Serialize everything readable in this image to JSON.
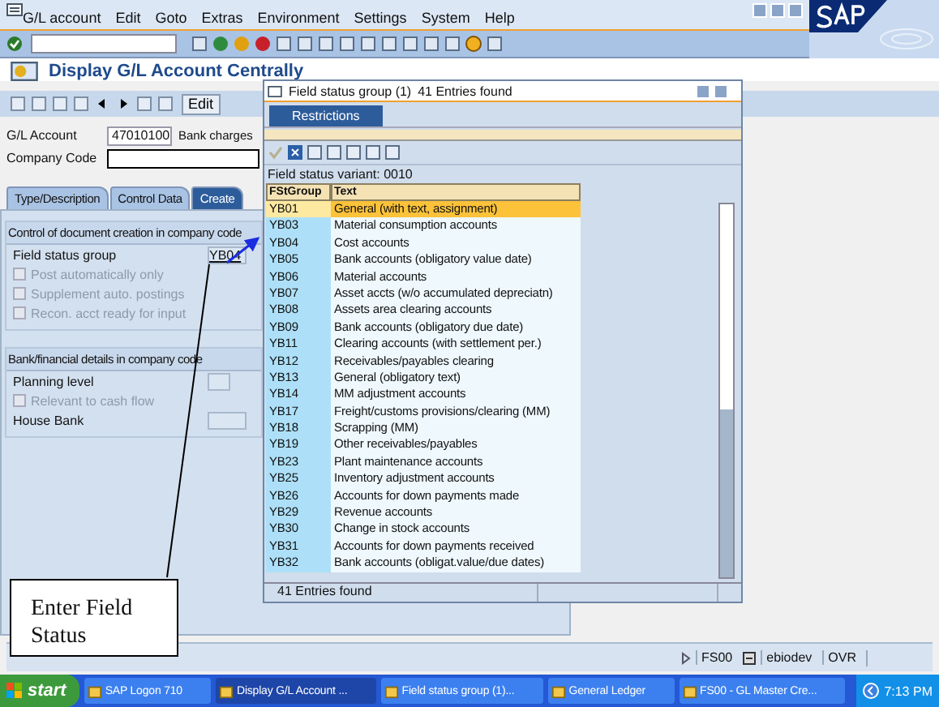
{
  "menu": [
    "G/L account",
    "Edit",
    "Goto",
    "Extras",
    "Environment",
    "Settings",
    "System",
    "Help"
  ],
  "title": "Display G/L Account Centrally",
  "app_toolbar": {
    "edit_button": "Edit"
  },
  "header_fields": [
    {
      "label": "G/L Account",
      "value": "47010100",
      "description": "Bank charges"
    },
    {
      "label": "Company Code"
    }
  ],
  "tabs": [
    {
      "label": "Type/Description",
      "selected": false
    },
    {
      "label": "Control Data",
      "selected": false
    },
    {
      "label": "Create",
      "selected": true
    }
  ],
  "doc_control": {
    "title": "Control of document creation in company code",
    "field_status_group": {
      "label": "Field status group",
      "value": "YB04"
    },
    "checkboxes": [
      {
        "label": "Post automatically only",
        "checked": false,
        "disabled": true
      },
      {
        "label": "Supplement auto. postings",
        "checked": false,
        "disabled": true
      },
      {
        "label": "Recon. acct ready for input",
        "checked": false,
        "disabled": true
      }
    ]
  },
  "bank_details": {
    "title": "Bank/financial details in company code",
    "planning_level": {
      "label": "Planning level"
    },
    "cash_flow": {
      "label": "Relevant to cash flow",
      "checked": false,
      "disabled": true
    },
    "house_bank": {
      "label": "House Bank"
    }
  },
  "popup": {
    "title": "Field status group (1)",
    "entries": "41 Entries found",
    "tab": "Restrictions",
    "variant": "Field status variant: 0010",
    "columns": [
      "FStGroup",
      "Text"
    ],
    "rows": [
      {
        "code": "YB01",
        "text": "General (with text, assignment)",
        "selected": true
      },
      {
        "code": "YB03",
        "text": "Material consumption accounts",
        "selected": false
      },
      {
        "code": "YB04",
        "text": "Cost accounts",
        "selected": false
      },
      {
        "code": "YB05",
        "text": "Bank accounts (obligatory value date)",
        "selected": false
      },
      {
        "code": "YB06",
        "text": "Material accounts",
        "selected": false
      },
      {
        "code": "YB07",
        "text": "Asset accts (w/o accumulated depreciatn)",
        "selected": false
      },
      {
        "code": "YB08",
        "text": "Assets area clearing accounts",
        "selected": false
      },
      {
        "code": "YB09",
        "text": "Bank accounts (obligatory due date)",
        "selected": false
      },
      {
        "code": "YB11",
        "text": "Clearing accounts (with settlement per.)",
        "selected": false
      },
      {
        "code": "YB12",
        "text": "Receivables/payables clearing",
        "selected": false
      },
      {
        "code": "YB13",
        "text": "General (obligatory text)",
        "selected": false
      },
      {
        "code": "YB14",
        "text": "MM adjustment accounts",
        "selected": false
      },
      {
        "code": "YB17",
        "text": "Freight/customs provisions/clearing (MM)",
        "selected": false
      },
      {
        "code": "YB18",
        "text": "Scrapping (MM)",
        "selected": false
      },
      {
        "code": "YB19",
        "text": "Other receivables/payables",
        "selected": false
      },
      {
        "code": "YB23",
        "text": "Plant maintenance accounts",
        "selected": false
      },
      {
        "code": "YB25",
        "text": "Inventory adjustment accounts",
        "selected": false
      },
      {
        "code": "YB26",
        "text": "Accounts for down payments made",
        "selected": false
      },
      {
        "code": "YB29",
        "text": "Revenue accounts",
        "selected": false
      },
      {
        "code": "YB30",
        "text": "Change in stock accounts",
        "selected": false
      },
      {
        "code": "YB31",
        "text": "Accounts for down payments received",
        "selected": false
      },
      {
        "code": "YB32",
        "text": "Bank accounts (obligat.value/due dates)",
        "selected": false
      }
    ],
    "footer": "41 Entries found"
  },
  "callout": "Enter Field Status",
  "status_bar": {
    "transaction": "FS00",
    "server": "ebiodev",
    "mode": "OVR"
  },
  "taskbar": {
    "start": "start",
    "tasks": [
      {
        "label": "SAP Logon 710",
        "selected": false
      },
      {
        "label": "Display G/L Account ...",
        "selected": true
      },
      {
        "label": "Field status group (1)...",
        "selected": false
      },
      {
        "label": "General Ledger",
        "selected": false
      },
      {
        "label": "FS00 - GL Master Cre...",
        "selected": false
      }
    ],
    "clock": "7:13 PM"
  }
}
